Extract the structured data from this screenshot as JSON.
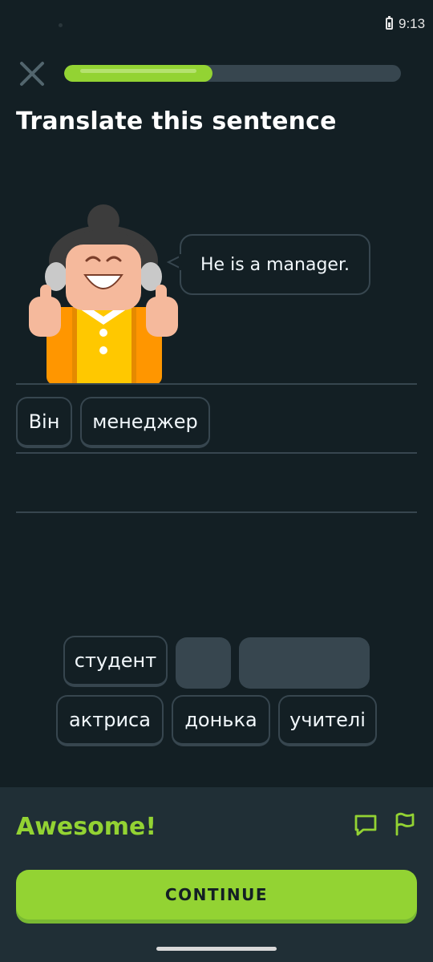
{
  "status_bar": {
    "time": "9:13"
  },
  "header": {
    "progress": 0.44,
    "title": "Translate this sentence"
  },
  "prompt": {
    "speech_text": "He is a manager."
  },
  "answer": {
    "selected_words": [
      "Він",
      "менеджер"
    ]
  },
  "word_bank": {
    "row1": [
      "студент"
    ],
    "row2": [
      "актриса",
      "донька",
      "учителі"
    ]
  },
  "feedback": {
    "title": "Awesome!",
    "continue_label": "CONTINUE"
  },
  "colors": {
    "background": "#131f24",
    "accent_green": "#93d333",
    "border": "#37464f",
    "panel": "#202f36"
  }
}
